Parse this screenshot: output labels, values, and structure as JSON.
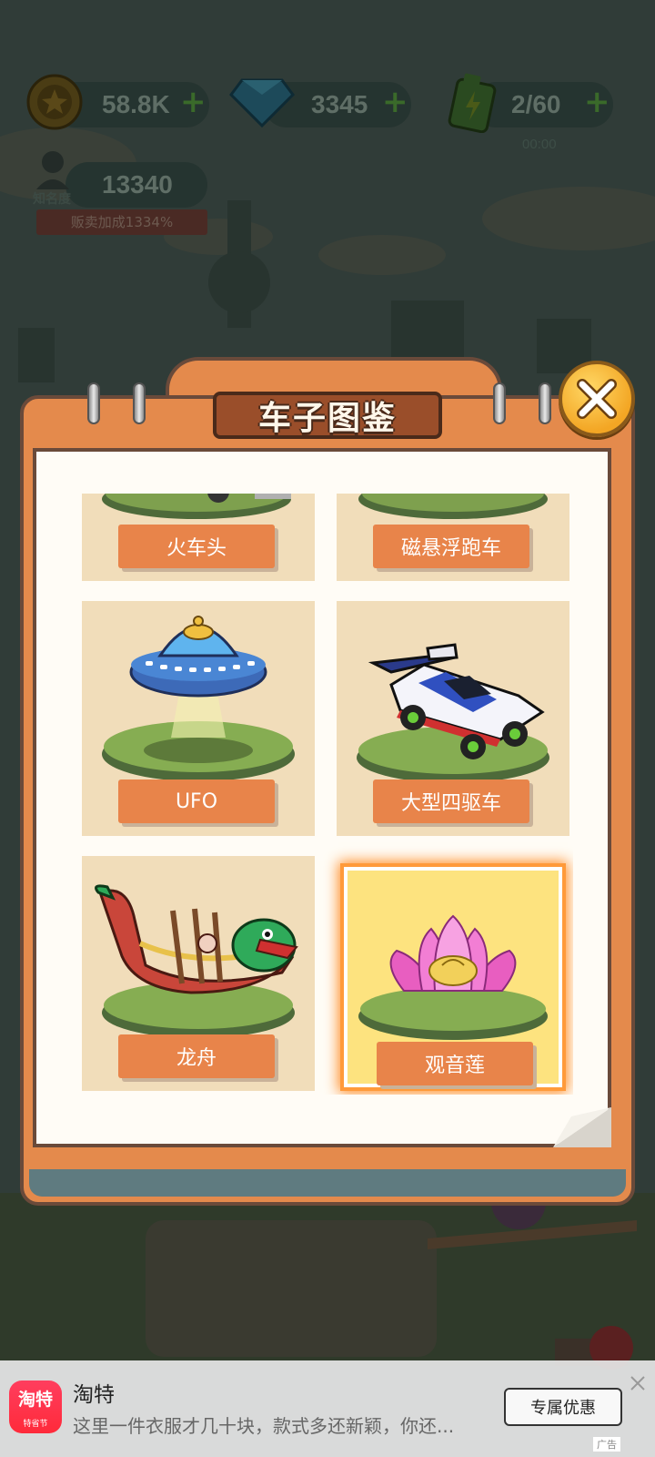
{
  "hud": {
    "coins": "58.8K",
    "gems": "3345",
    "energy": "2/60",
    "energy_timer": "00:00",
    "fame_label": "知名度",
    "fame_value": "13340",
    "fame_bonus": "贩卖加成1334%"
  },
  "modal": {
    "title": "车子图鉴",
    "cards": [
      {
        "label": "火车头",
        "icon": "locomotive-icon",
        "selected": false
      },
      {
        "label": "磁悬浮跑车",
        "icon": "maglev-car-icon",
        "selected": false
      },
      {
        "label": "UFO",
        "icon": "ufo-icon",
        "selected": false
      },
      {
        "label": "大型四驱车",
        "icon": "4wd-car-icon",
        "selected": false
      },
      {
        "label": "龙舟",
        "icon": "dragon-boat-icon",
        "selected": false
      },
      {
        "label": "观音莲",
        "icon": "lotus-icon",
        "selected": true
      }
    ]
  },
  "ad": {
    "app_name": "淘特",
    "logo_text": "淘特",
    "logo_sub": "特省节",
    "description": "这里一件衣服才几十块，款式多还新颖，你还...",
    "cta": "专属优惠",
    "tag": "广告"
  },
  "colors": {
    "panel_orange": "#e48a4c",
    "label_orange": "#e8844a",
    "card_bg": "#f1ddba",
    "selected_bg": "#fde37f",
    "selected_glow": "#ff8a22"
  }
}
